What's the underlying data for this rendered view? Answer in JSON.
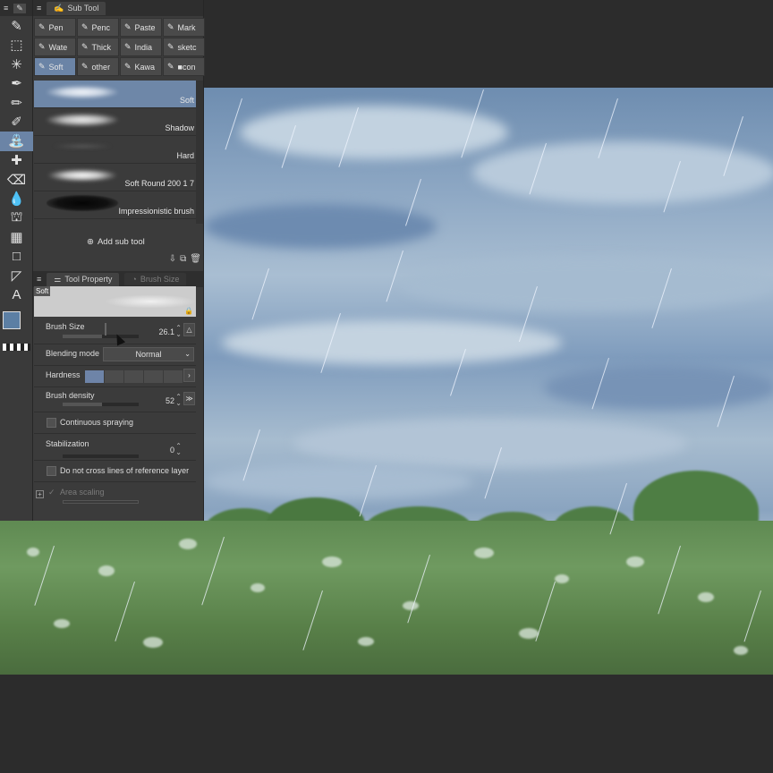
{
  "subtool_panel": {
    "tab_label": "Sub Tool",
    "groups": [
      {
        "label": "Pen",
        "icon": "pen-icon",
        "active": false
      },
      {
        "label": "Penc",
        "icon": "pencil-icon",
        "active": false
      },
      {
        "label": "Paste",
        "icon": "pastel-icon",
        "active": false
      },
      {
        "label": "Mark",
        "icon": "marker-icon",
        "active": false
      },
      {
        "label": "Wate",
        "icon": "watercolor-icon",
        "active": false
      },
      {
        "label": "Thick",
        "icon": "thick-paint-icon",
        "active": false
      },
      {
        "label": "India",
        "icon": "india-ink-icon",
        "active": false
      },
      {
        "label": "sketc",
        "icon": "sketch-icon",
        "active": false
      },
      {
        "label": "Soft",
        "icon": "airbrush-icon",
        "active": true
      },
      {
        "label": "other",
        "icon": "other-brush-icon",
        "active": false
      },
      {
        "label": "Kawa",
        "icon": "kawa-brush-icon",
        "active": false
      },
      {
        "label": "■con",
        "icon": "con-brush-icon",
        "active": false
      }
    ],
    "brushes": [
      {
        "name": "Soft",
        "selected": true
      },
      {
        "name": "Shadow",
        "selected": false
      },
      {
        "name": "Hard",
        "selected": false
      },
      {
        "name": "Soft Round 200 1 7",
        "selected": false
      },
      {
        "name": "Impressionistic  brush",
        "selected": false
      }
    ],
    "add_sub_tool": "Add sub tool"
  },
  "tool_property": {
    "tab_label": "Tool Property",
    "tab2_label": "Brush Size",
    "preview_label": "Soft",
    "brush_size": {
      "label": "Brush Size",
      "value": "26.1",
      "fraction": 0.52
    },
    "blending_mode": {
      "label": "Blending mode",
      "value": "Normal"
    },
    "hardness": {
      "label": "Hardness",
      "level": 1,
      "levels": 5
    },
    "brush_density": {
      "label": "Brush density",
      "value": "52",
      "fraction": 0.52
    },
    "continuous_spraying": {
      "label": "Continuous spraying",
      "checked": false
    },
    "stabilization": {
      "label": "Stabilization",
      "value": "0"
    },
    "do_not_cross": {
      "label": "Do not cross lines of reference layer",
      "checked": false
    },
    "area_scaling": {
      "label": "Area scaling",
      "checked": true
    }
  },
  "colors": {
    "main": "#5c7fa4",
    "sub": "#f2f2f2",
    "accent": "#6b84a6"
  },
  "toolbar_icons": [
    "pen-tool-icon",
    "selection-icon",
    "magic-wand-icon",
    "pen-icon",
    "pencil-icon",
    "brush-icon",
    "airbrush-icon",
    "sparkle-icon",
    "eraser-icon",
    "blend-icon",
    "fill-icon",
    "gradient-icon",
    "rectangle-icon",
    "ruler-icon",
    "text-icon"
  ],
  "toolbar_glyphs": [
    "✎",
    "⬚",
    "✳",
    "✒",
    "✏",
    "✐",
    "⛲",
    "✚",
    "⌫",
    "💧",
    "⛫",
    "▦",
    "□",
    "◸",
    "A"
  ]
}
